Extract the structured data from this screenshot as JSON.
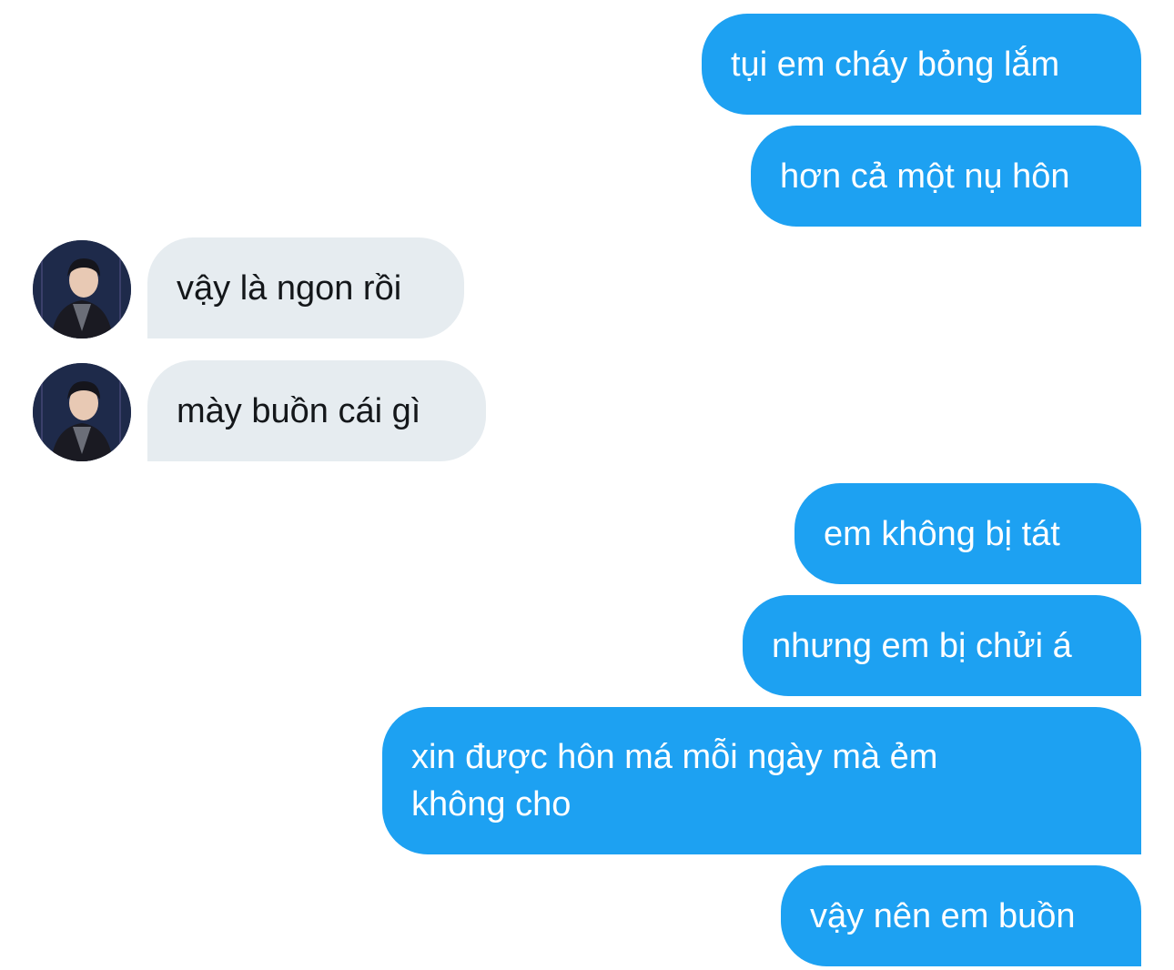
{
  "colors": {
    "outgoing_bubble": "#1da1f2",
    "incoming_bubble": "#e6ecf0",
    "outgoing_text": "#ffffff",
    "incoming_text": "#14171a"
  },
  "messages": [
    {
      "direction": "outgoing",
      "text": "tụi em cháy bỏng lắm"
    },
    {
      "direction": "outgoing",
      "text": "hơn cả một nụ hôn"
    },
    {
      "direction": "incoming",
      "text": "vậy là ngon rồi"
    },
    {
      "direction": "incoming",
      "text": "mày buồn cái gì"
    },
    {
      "direction": "outgoing",
      "text": "em không bị tát"
    },
    {
      "direction": "outgoing",
      "text": "nhưng em bị chửi á"
    },
    {
      "direction": "outgoing",
      "text": "xin được hôn má mỗi ngày mà ẻm không cho"
    },
    {
      "direction": "outgoing",
      "text": "vậy nên em buồn"
    }
  ],
  "icons": {
    "avatar": "user-avatar-photo"
  }
}
